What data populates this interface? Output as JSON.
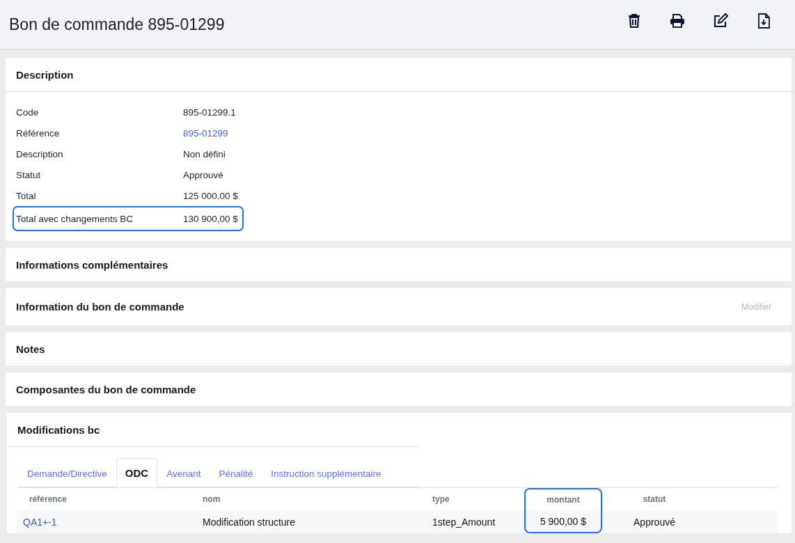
{
  "header": {
    "title": "Bon de commande 895-01299"
  },
  "description": {
    "title": "Description",
    "fields": [
      {
        "label": "Code",
        "value": "895-01299.1",
        "kind": "text",
        "highlighted": false
      },
      {
        "label": "Référence",
        "value": "895-01299",
        "kind": "link",
        "highlighted": false
      },
      {
        "label": "Description",
        "value": "Non défini",
        "kind": "text",
        "highlighted": false
      },
      {
        "label": "Statut",
        "value": "Approuvé",
        "kind": "text",
        "highlighted": false
      },
      {
        "label": "Total",
        "value": "125 000,00 $",
        "kind": "text",
        "highlighted": false
      },
      {
        "label": "Total avec changements BC",
        "value": "130 900,00 $",
        "kind": "text",
        "highlighted": true
      }
    ]
  },
  "sections": [
    {
      "title": "Informations complémentaires"
    },
    {
      "title": "Information du bon de commande",
      "action": "Modifier"
    },
    {
      "title": "Notes"
    },
    {
      "title": "Composantes du bon de commande"
    }
  ],
  "modifications": {
    "title": "Modifications bc",
    "tabs": [
      {
        "label": "Demande/Directive",
        "selected": false
      },
      {
        "label": "ODC",
        "selected": true
      },
      {
        "label": "Avenant",
        "selected": false
      },
      {
        "label": "Pénalité",
        "selected": false
      },
      {
        "label": "Instruction supplémentaire",
        "selected": false
      }
    ],
    "table": {
      "columns": [
        {
          "label": "référence",
          "highlighted": false
        },
        {
          "label": "nom",
          "highlighted": false
        },
        {
          "label": "type",
          "highlighted": false
        },
        {
          "label": "montant",
          "highlighted": true
        },
        {
          "label": "statut",
          "highlighted": false
        }
      ],
      "rows": [
        {
          "cells": [
            "QA1+-1",
            "Modification structure",
            "1step_Amount",
            "5 900,00 $",
            "Approuvé"
          ]
        }
      ]
    }
  }
}
